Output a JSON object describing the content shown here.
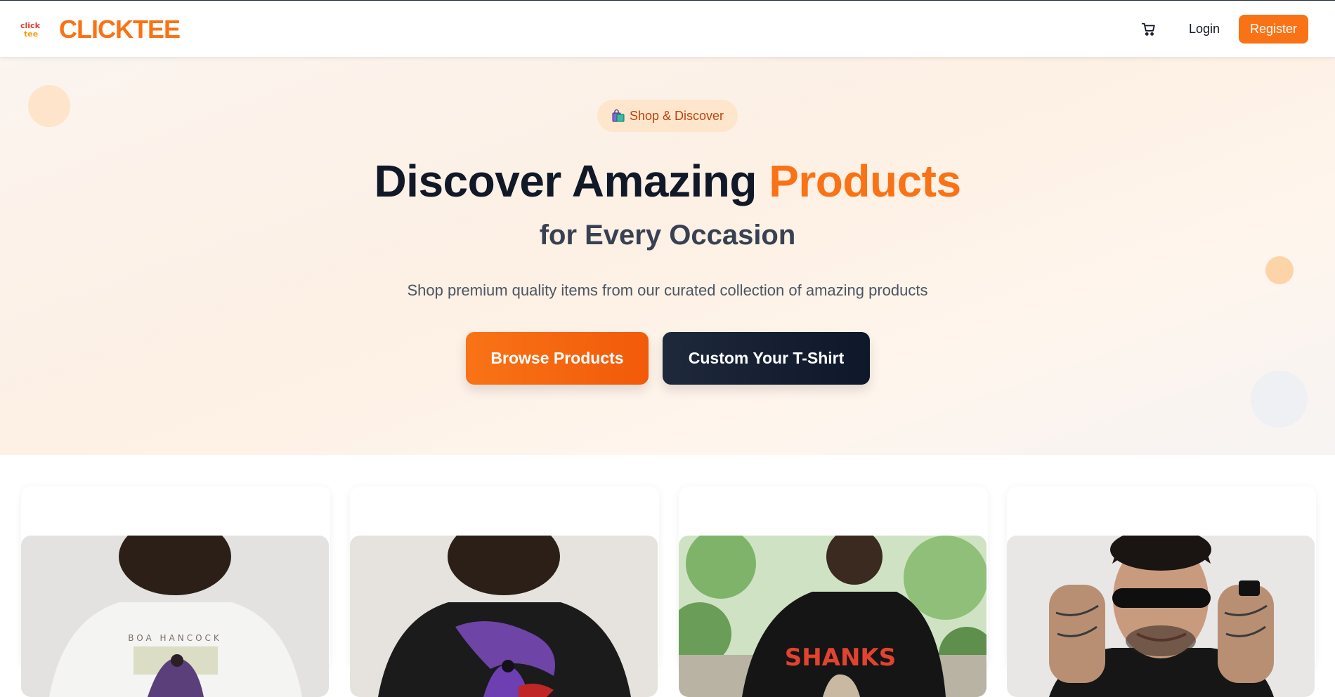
{
  "brand": {
    "name": "CLICKTEE",
    "logo_text": "click tee",
    "accent_color": "#f97316"
  },
  "nav": {
    "cart_icon": "shopping-cart-icon",
    "login_label": "Login",
    "register_label": "Register"
  },
  "hero": {
    "badge": {
      "icon": "shopping-bags-icon",
      "label": "Shop & Discover"
    },
    "headline_main": "Discover Amazing",
    "headline_accent": "Products",
    "subheadline": "for Every Occasion",
    "description": "Shop premium quality items from our curated collection of amazing products",
    "primary_button": "Browse Products",
    "secondary_button": "Custom Your T-Shirt"
  },
  "products": [
    {
      "image_text": "BOA HANCOCK",
      "shirt_color": "#f3f3f3"
    },
    {
      "image_text": "",
      "shirt_color": "#1b1b1b"
    },
    {
      "image_text": "SHANKS",
      "shirt_color": "#151515"
    },
    {
      "image_text": "",
      "shirt_color": "#161616"
    }
  ]
}
